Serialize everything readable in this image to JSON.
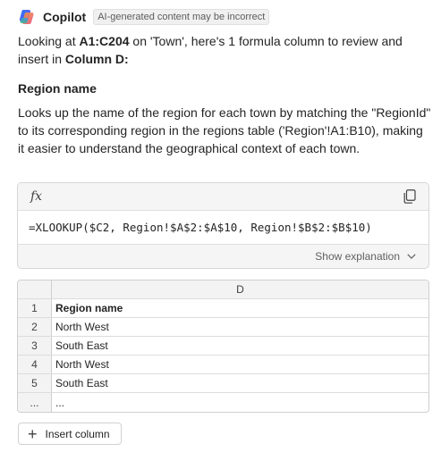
{
  "header": {
    "title": "Copilot",
    "badge": "AI-generated content may be incorrect",
    "logo_icon": "copilot-logo"
  },
  "intro": {
    "p1": "Looking at ",
    "range": "A1:C204",
    "p2": " on 'Town', here's 1 formula column to review and insert in ",
    "column": "Column D:"
  },
  "section": {
    "title": "Region name",
    "description": "Looks up the name of the region for each town by matching the \"RegionId\" to its corresponding region in the regions table ('Region'!A1:B10), making it easier to understand the geographical context of each town."
  },
  "formula_card": {
    "fx_label": "fx",
    "formula": "=XLOOKUP($C2, Region!$A$2:$A$10, Region!$B$2:$B$10)",
    "explain_label": "Show explanation",
    "copy_icon": "copy-icon",
    "chevron_icon": "chevron-down-icon"
  },
  "grid": {
    "column_header": "D",
    "rows": [
      {
        "num": "1",
        "value": "Region name"
      },
      {
        "num": "2",
        "value": "North West"
      },
      {
        "num": "3",
        "value": "South East"
      },
      {
        "num": "4",
        "value": "North West"
      },
      {
        "num": "5",
        "value": "South East"
      },
      {
        "num": "...",
        "value": "..."
      }
    ]
  },
  "actions": {
    "insert_label": "Insert column",
    "insert_icon": "plus-icon"
  },
  "colors": {
    "text": "#242424",
    "muted": "#616161",
    "card_bg": "#f5f5f5",
    "border": "#d6d6d6"
  }
}
